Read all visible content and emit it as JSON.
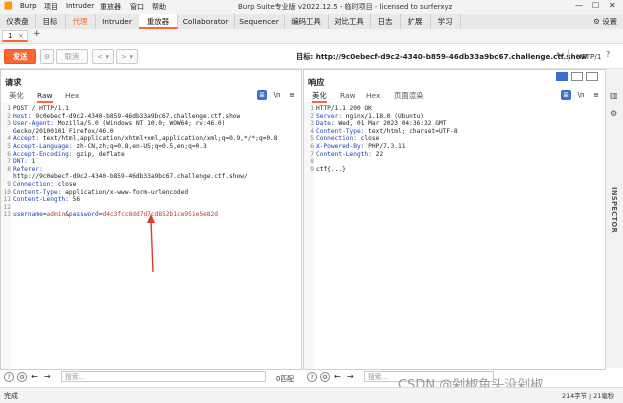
{
  "app": {
    "menus": [
      "Burp",
      "项目",
      "Intruder",
      "重放器",
      "窗口",
      "帮助"
    ],
    "title": "Burp Suite专业版  v2022.12.5 - 临时项目 - licensed to surferxyz"
  },
  "main_tabs": [
    {
      "label": "仪表盘"
    },
    {
      "label": "目标"
    },
    {
      "label": "代理",
      "active": false,
      "accent": true
    },
    {
      "label": "Intruder"
    },
    {
      "label": "重放器",
      "active": true
    },
    {
      "label": "Collaborator"
    },
    {
      "label": "Sequencer"
    },
    {
      "label": "编码工具"
    },
    {
      "label": "对比工具"
    },
    {
      "label": "日志"
    },
    {
      "label": "扩展"
    },
    {
      "label": "学习"
    }
  ],
  "settings_label": "设置",
  "sub_tab": {
    "label": "1",
    "close": "×",
    "add": "+"
  },
  "toolbar": {
    "send": "发送",
    "cancel": "取消",
    "target": "目标: http://9c0ebecf-d9c2-4340-b859-46db33a9bc67.challenge.ctf.show",
    "http": "HTTP/1"
  },
  "request": {
    "title": "请求",
    "tabs": [
      "美化",
      "Raw",
      "Hex"
    ],
    "active_tab": "Raw",
    "lines": [
      {
        "n": "1",
        "t": "POST / HTTP/1.1"
      },
      {
        "n": "2",
        "h": "Host:",
        "v": " 9c0ebecf-d9c2-4340-b859-46db33a9bc67.challenge.ctf.show"
      },
      {
        "n": "3",
        "h": "User-Agent:",
        "v": " Mozilla/5.0 (Windows NT 10.0; WOW64; rv:46.0)"
      },
      {
        "n": "",
        "t": "Gecko/20100101 Firefox/46.0"
      },
      {
        "n": "4",
        "h": "Accept:",
        "v": " text/html,application/xhtml+xml,application/xml;q=0.9,*/*;q=0.8"
      },
      {
        "n": "5",
        "h": "Accept-Language:",
        "v": " zh-CN,zh;q=0.8,en-US;q=0.5,en;q=0.3"
      },
      {
        "n": "6",
        "h": "Accept-Encoding:",
        "v": " gzip, deflate"
      },
      {
        "n": "7",
        "h": "DNT:",
        "v": " 1"
      },
      {
        "n": "8",
        "h": "Referer:",
        "v": ""
      },
      {
        "n": "",
        "t": "http://9c0ebecf-d9c2-4340-b859-46db33a9bc67.challenge.ctf.show/"
      },
      {
        "n": "9",
        "h": "Connection:",
        "v": " close"
      },
      {
        "n": "10",
        "h": "Content-Type:",
        "v": " application/x-www-form-urlencoded"
      },
      {
        "n": "11",
        "h": "Content-Length:",
        "v": " 56"
      },
      {
        "n": "12",
        "t": ""
      },
      {
        "n": "13",
        "body": true,
        "p1": "username",
        "v1": "admin",
        "p2": "password",
        "v2": "d4c3fcc8dd7d7cd852b1ce951e5e82d"
      }
    ]
  },
  "response": {
    "title": "响应",
    "tabs": [
      "美化",
      "Raw",
      "Hex",
      "页面渲染"
    ],
    "active_tab": "美化",
    "lines": [
      {
        "n": "1",
        "t": "HTTP/1.1 200 OK"
      },
      {
        "n": "2",
        "h": "Server:",
        "v": " nginx/1.18.0 (Ubuntu)"
      },
      {
        "n": "3",
        "h": "Date:",
        "v": " Wed, 01 Mar 2023 04:36:32 GMT"
      },
      {
        "n": "4",
        "h": "Content-Type:",
        "v": " text/html; charset=UTF-8"
      },
      {
        "n": "5",
        "h": "Connection:",
        "v": " close"
      },
      {
        "n": "6",
        "h": "X-Powered-By:",
        "v": " PHP/7.3.11"
      },
      {
        "n": "7",
        "h": "Content-Length:",
        "v": " 22"
      },
      {
        "n": "8",
        "t": ""
      },
      {
        "n": "9",
        "t": "ctf{...}"
      }
    ]
  },
  "inspector_label": "INSPECTOR",
  "search": {
    "left_placeholder": "搜索...",
    "left_matches": "0匹配",
    "right_placeholder": "搜索..."
  },
  "status": {
    "left": "完成",
    "right": "214字节 | 21毫秒"
  },
  "watermark": "CSDN @剁椒鱼头没剁椒",
  "colors": {
    "accent": "#ff6633",
    "header_name": "#1b3fb0",
    "param_value": "#c0392b"
  }
}
